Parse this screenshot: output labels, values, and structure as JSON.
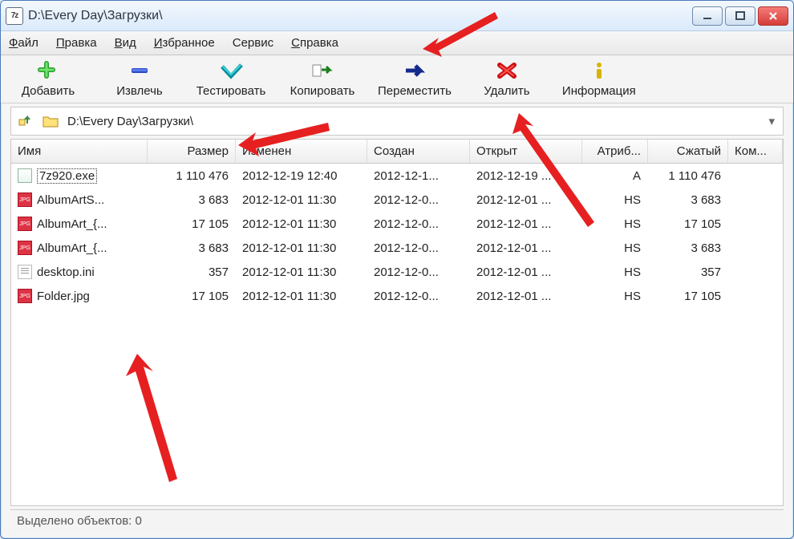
{
  "title": "D:\\Every Day\\Загрузки\\",
  "menubar": [
    {
      "label": "Файл",
      "u": 0
    },
    {
      "label": "Правка",
      "u": 0
    },
    {
      "label": "Вид",
      "u": 0
    },
    {
      "label": "Избранное",
      "u": 0
    },
    {
      "label": "Сервис",
      "u": -1
    },
    {
      "label": "Справка",
      "u": 0
    }
  ],
  "toolbar": [
    {
      "icon": "plus",
      "label": "Добавить"
    },
    {
      "icon": "minus",
      "label": "Извлечь"
    },
    {
      "icon": "test",
      "label": "Тестировать"
    },
    {
      "icon": "copy",
      "label": "Копировать"
    },
    {
      "icon": "move",
      "label": "Переместить"
    },
    {
      "icon": "delete",
      "label": "Удалить"
    },
    {
      "icon": "info",
      "label": "Информация"
    }
  ],
  "path": "D:\\Every Day\\Загрузки\\",
  "columns": [
    "Имя",
    "Размер",
    "Изменен",
    "Создан",
    "Открыт",
    "Атриб...",
    "Сжатый",
    "Ком..."
  ],
  "files": [
    {
      "type": "exe",
      "name": "7z920.exe",
      "size": "1 110 476",
      "mod": "2012-12-19 12:40",
      "crt": "2012-12-1...",
      "opn": "2012-12-19 ...",
      "attr": "A",
      "pack": "1 110 476",
      "sel": true
    },
    {
      "type": "jpg",
      "name": "AlbumArtS...",
      "size": "3 683",
      "mod": "2012-12-01 11:30",
      "crt": "2012-12-0...",
      "opn": "2012-12-01 ...",
      "attr": "HS",
      "pack": "3 683"
    },
    {
      "type": "jpg",
      "name": "AlbumArt_{...",
      "size": "17 105",
      "mod": "2012-12-01 11:30",
      "crt": "2012-12-0...",
      "opn": "2012-12-01 ...",
      "attr": "HS",
      "pack": "17 105"
    },
    {
      "type": "jpg",
      "name": "AlbumArt_{...",
      "size": "3 683",
      "mod": "2012-12-01 11:30",
      "crt": "2012-12-0...",
      "opn": "2012-12-01 ...",
      "attr": "HS",
      "pack": "3 683"
    },
    {
      "type": "ini",
      "name": "desktop.ini",
      "size": "357",
      "mod": "2012-12-01 11:30",
      "crt": "2012-12-0...",
      "opn": "2012-12-01 ...",
      "attr": "HS",
      "pack": "357"
    },
    {
      "type": "jpg",
      "name": "Folder.jpg",
      "size": "17 105",
      "mod": "2012-12-01 11:30",
      "crt": "2012-12-0...",
      "opn": "2012-12-01 ...",
      "attr": "HS",
      "pack": "17 105"
    }
  ],
  "status": "Выделено объектов: 0"
}
